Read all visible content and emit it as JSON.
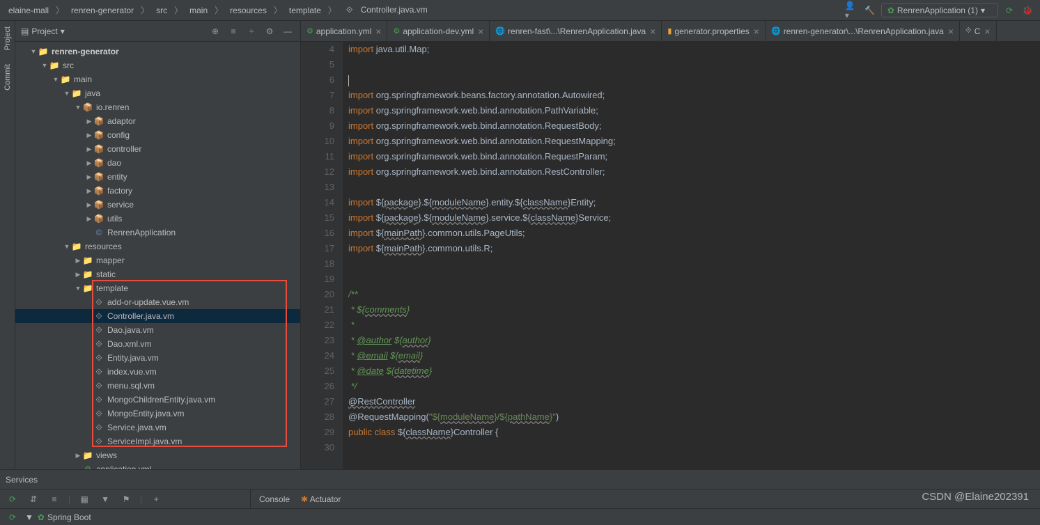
{
  "breadcrumb": [
    "elaine-mall",
    "renren-generator",
    "src",
    "main",
    "resources",
    "template",
    "Controller.java.vm"
  ],
  "run_config": "RenrenApplication (1)",
  "left_gutter": {
    "project": "Project",
    "commit": "Commit"
  },
  "panel": {
    "title": "Project"
  },
  "tree": [
    {
      "d": 0,
      "arrow": "▼",
      "icon": "📁",
      "cls": "folder-blue bold",
      "label": "renren-generator"
    },
    {
      "d": 1,
      "arrow": "▼",
      "icon": "📁",
      "cls": "folder-blue",
      "label": "src"
    },
    {
      "d": 2,
      "arrow": "▼",
      "icon": "📁",
      "cls": "folder-blue",
      "label": "main"
    },
    {
      "d": 3,
      "arrow": "▼",
      "icon": "📁",
      "cls": "folder-blue",
      "label": "java"
    },
    {
      "d": 4,
      "arrow": "▼",
      "icon": "📦",
      "cls": "pkg",
      "label": "io.renren"
    },
    {
      "d": 5,
      "arrow": "▶",
      "icon": "📦",
      "cls": "pkg",
      "label": "adaptor"
    },
    {
      "d": 5,
      "arrow": "▶",
      "icon": "📦",
      "cls": "pkg",
      "label": "config"
    },
    {
      "d": 5,
      "arrow": "▶",
      "icon": "📦",
      "cls": "pkg",
      "label": "controller"
    },
    {
      "d": 5,
      "arrow": "▶",
      "icon": "📦",
      "cls": "pkg",
      "label": "dao"
    },
    {
      "d": 5,
      "arrow": "▶",
      "icon": "📦",
      "cls": "pkg",
      "label": "entity"
    },
    {
      "d": 5,
      "arrow": "▶",
      "icon": "📦",
      "cls": "pkg",
      "label": "factory"
    },
    {
      "d": 5,
      "arrow": "▶",
      "icon": "📦",
      "cls": "pkg",
      "label": "service"
    },
    {
      "d": 5,
      "arrow": "▶",
      "icon": "📦",
      "cls": "pkg",
      "label": "utils"
    },
    {
      "d": 5,
      "arrow": "",
      "icon": "©",
      "cls": "java-icon",
      "label": "RenrenApplication"
    },
    {
      "d": 3,
      "arrow": "▼",
      "icon": "📁",
      "cls": "folder",
      "label": "resources"
    },
    {
      "d": 4,
      "arrow": "▶",
      "icon": "📁",
      "cls": "folder",
      "label": "mapper"
    },
    {
      "d": 4,
      "arrow": "▶",
      "icon": "📁",
      "cls": "folder",
      "label": "static"
    },
    {
      "d": 4,
      "arrow": "▼",
      "icon": "📁",
      "cls": "folder",
      "label": "template",
      "boxstart": true
    },
    {
      "d": 5,
      "arrow": "",
      "icon": "⟐",
      "cls": "vm-icon",
      "label": "add-or-update.vue.vm"
    },
    {
      "d": 5,
      "arrow": "",
      "icon": "⟐",
      "cls": "vm-icon",
      "label": "Controller.java.vm",
      "selected": true
    },
    {
      "d": 5,
      "arrow": "",
      "icon": "⟐",
      "cls": "vm-icon",
      "label": "Dao.java.vm"
    },
    {
      "d": 5,
      "arrow": "",
      "icon": "⟐",
      "cls": "vm-icon",
      "label": "Dao.xml.vm"
    },
    {
      "d": 5,
      "arrow": "",
      "icon": "⟐",
      "cls": "vm-icon",
      "label": "Entity.java.vm"
    },
    {
      "d": 5,
      "arrow": "",
      "icon": "⟐",
      "cls": "vm-icon",
      "label": "index.vue.vm"
    },
    {
      "d": 5,
      "arrow": "",
      "icon": "⟐",
      "cls": "vm-icon",
      "label": "menu.sql.vm"
    },
    {
      "d": 5,
      "arrow": "",
      "icon": "⟐",
      "cls": "vm-icon",
      "label": "MongoChildrenEntity.java.vm"
    },
    {
      "d": 5,
      "arrow": "",
      "icon": "⟐",
      "cls": "vm-icon",
      "label": "MongoEntity.java.vm"
    },
    {
      "d": 5,
      "arrow": "",
      "icon": "⟐",
      "cls": "vm-icon",
      "label": "Service.java.vm"
    },
    {
      "d": 5,
      "arrow": "",
      "icon": "⟐",
      "cls": "vm-icon",
      "label": "ServiceImpl.java.vm",
      "boxend": true
    },
    {
      "d": 4,
      "arrow": "▶",
      "icon": "📁",
      "cls": "folder",
      "label": "views"
    },
    {
      "d": 4,
      "arrow": "",
      "icon": "⚙",
      "cls": "green",
      "label": "application.yml"
    }
  ],
  "tabs": [
    {
      "icon": "⚙",
      "cls": "green",
      "label": "application.yml"
    },
    {
      "icon": "⚙",
      "cls": "green",
      "label": "application-dev.yml"
    },
    {
      "icon": "🌐",
      "cls": "globe",
      "label": "renren-fast\\...\\RenrenApplication.java"
    },
    {
      "icon": "▮",
      "cls": "stats",
      "label": "generator.properties"
    },
    {
      "icon": "🌐",
      "cls": "globe",
      "label": "renren-generator\\...\\RenrenApplication.java"
    },
    {
      "icon": "⟐",
      "cls": "vm-icon",
      "label": "C"
    }
  ],
  "gutter_lines": [
    "4",
    "5",
    "6",
    "7",
    "8",
    "9",
    "10",
    "11",
    "12",
    "13",
    "14",
    "15",
    "16",
    "17",
    "18",
    "19",
    "20",
    "21",
    "22",
    "23",
    "24",
    "25",
    "26",
    "27",
    "28",
    "29",
    "30"
  ],
  "code": {
    "l4": {
      "kw": "import",
      "txt": " java.util.Map;"
    },
    "l7": {
      "kw": "import",
      "txt": " org.springframework.beans.factory.annotation.Autowired;"
    },
    "l8": {
      "kw": "import",
      "txt": " org.springframework.web.bind.annotation.PathVariable;"
    },
    "l9": {
      "kw": "import",
      "txt": " org.springframework.web.bind.annotation.RequestBody;"
    },
    "l10": {
      "kw": "import",
      "txt": " org.springframework.web.bind.annotation.RequestMapping;"
    },
    "l11": {
      "kw": "import",
      "txt": " org.springframework.web.bind.annotation.RequestParam;"
    },
    "l12": {
      "kw": "import",
      "txt": " org.springframework.web.bind.annotation.RestController;"
    },
    "l14": {
      "kw": "import",
      "p1": "${",
      "v1": "package",
      "p2": "}.${",
      "v2": "moduleName",
      "p3": "}.entity.${",
      "v3": "className",
      "p4": "}Entity;"
    },
    "l15": {
      "kw": "import",
      "p1": "${",
      "v1": "package",
      "p2": "}.${",
      "v2": "moduleName",
      "p3": "}.service.${",
      "v3": "className",
      "p4": "}Service;"
    },
    "l16": {
      "kw": "import",
      "p1": "${",
      "v1": "mainPath",
      "p2": "}.common.utils.PageUtils;"
    },
    "l17": {
      "kw": "import",
      "p1": "${",
      "v1": "mainPath",
      "p2": "}.common.utils.R;"
    },
    "l21": "/**",
    "l22": {
      "s": " * ${",
      "v": "comments",
      "e": "}"
    },
    "l23": " *",
    "l24": {
      "s": " * ",
      "t": "@author",
      "m": " ${",
      "v": "author",
      "e": "}"
    },
    "l25": {
      "s": " * ",
      "t": "@email",
      "m": " ${",
      "v": "email",
      "e": "}"
    },
    "l26": {
      "s": " * ",
      "t": "@date",
      "m": " ${",
      "v": "datetime",
      "e": "}"
    },
    "l27": " */",
    "l28": "@RestController",
    "l29": {
      "a": "@RequestMapping(",
      "s": "\"${",
      "v1": "moduleName",
      "m": "}/${",
      "v2": "pathName",
      "e": "}\"",
      "c": ")"
    },
    "l30": {
      "kw1": "public",
      "kw2": "class",
      "p1": "${",
      "v": "className",
      "p2": "}Controller {"
    }
  },
  "services": {
    "title": "Services",
    "console": "Console",
    "actuator": "Actuator",
    "springboot": "Spring Boot"
  },
  "watermark": "CSDN @Elaine202391"
}
